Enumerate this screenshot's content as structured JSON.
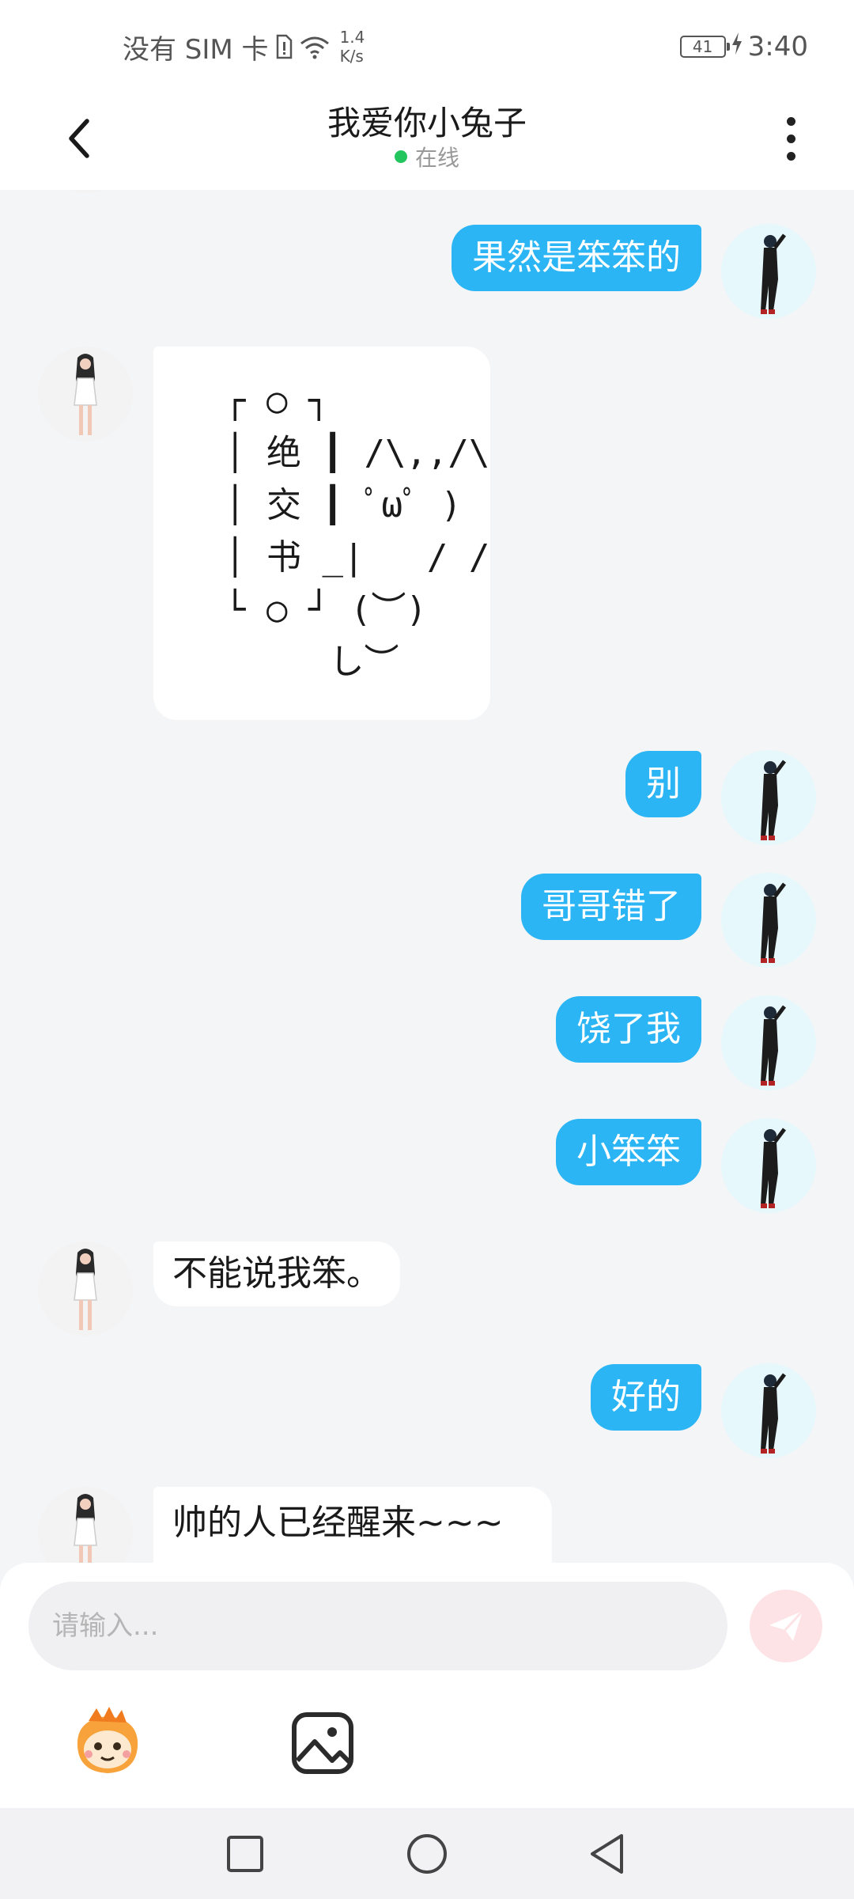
{
  "status_bar": {
    "carrier": "没有 SIM 卡",
    "net_speed_value": "1.4",
    "net_speed_unit": "K/s",
    "battery": "41",
    "time": "3:40"
  },
  "header": {
    "title": "我爱你小兔子",
    "status": "在线"
  },
  "messages": [
    {
      "side": "out",
      "text": "果然是笨笨的"
    },
    {
      "side": "in",
      "text": "┌ ○ ┐\n│ 绝 ┃ /\\,,/\\\n│ 交 ┃ ﾟωﾟ )\n│ 书 _|   / /\n└ ○ ┘ (︶)\n     し︶"
    },
    {
      "side": "out",
      "text": "别"
    },
    {
      "side": "out",
      "text": "哥哥错了"
    },
    {
      "side": "out",
      "text": "饶了我"
    },
    {
      "side": "out",
      "text": "小笨笨"
    },
    {
      "side": "in",
      "text": "不能说我笨。"
    },
    {
      "side": "out",
      "text": "好的"
    },
    {
      "side": "in",
      "text": "帅的人已经醒来~~~"
    }
  ],
  "input": {
    "placeholder": "请输入..."
  },
  "icons": {
    "back": "chevron-left-icon",
    "more": "more-vertical-icon",
    "send": "send-icon",
    "emoji": "emoji-sticker-icon",
    "image": "image-icon",
    "nav_recent": "square-icon",
    "nav_home": "circle-icon",
    "nav_back": "triangle-back-icon"
  },
  "colors": {
    "outgoing_bubble": "#2bb5f5",
    "incoming_bubble": "#ffffff",
    "online_dot": "#22c55e",
    "send_button": "#fde3e6"
  }
}
